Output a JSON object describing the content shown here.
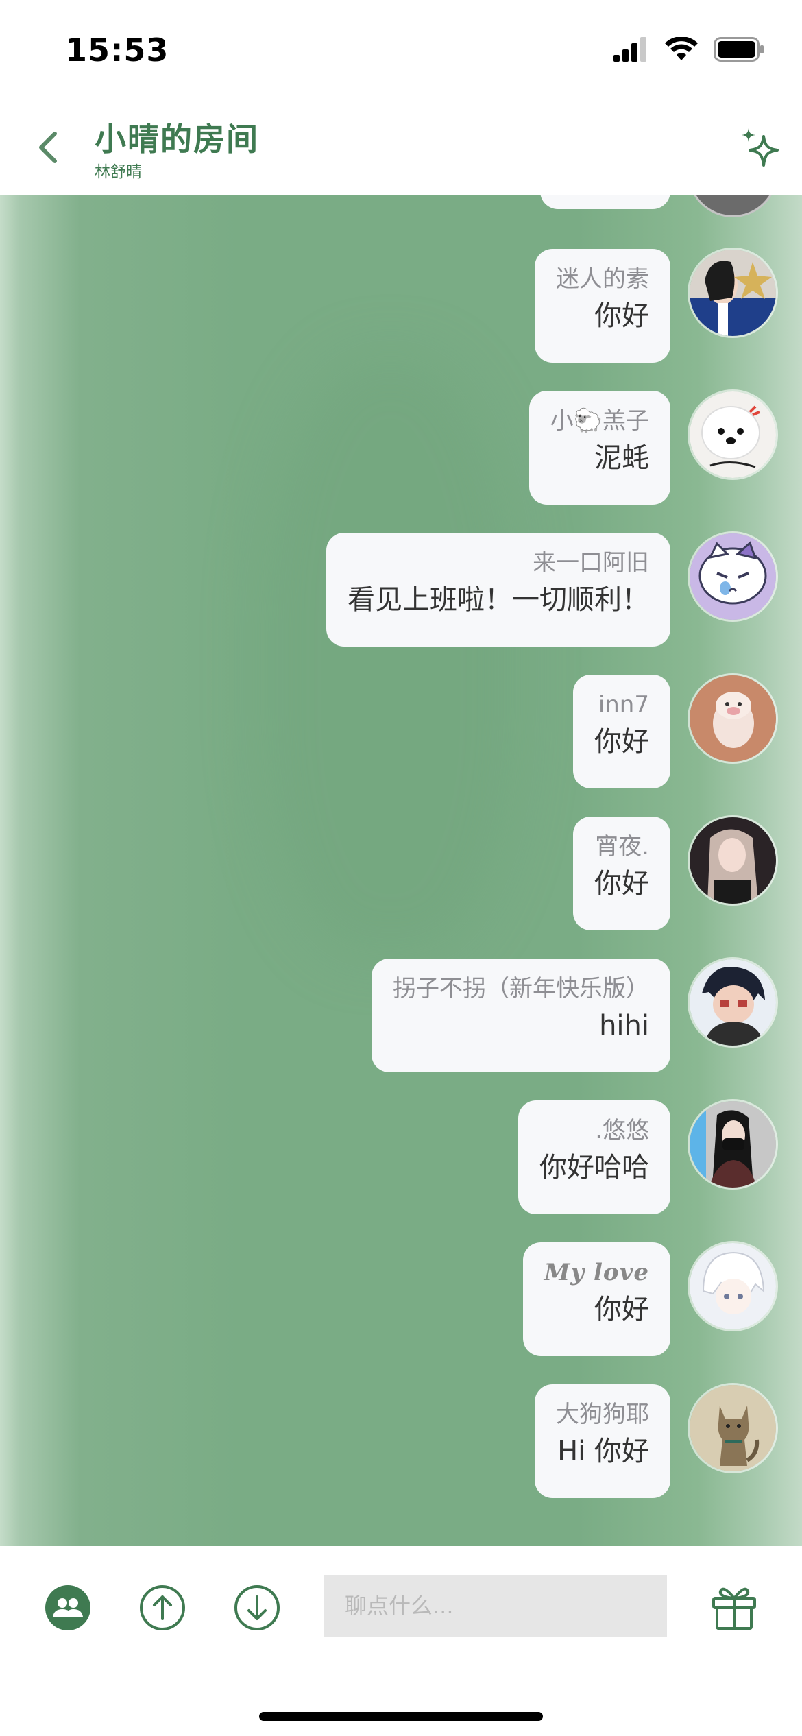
{
  "status_bar": {
    "time": "15:53"
  },
  "header": {
    "title": "小晴的房间",
    "subtitle": "林舒晴",
    "accent_color": "#3f7a51"
  },
  "messages": [
    {
      "name": "迷人的素",
      "text": "你好",
      "avatar": "avatar-girl-star"
    },
    {
      "name": "小🐑羔子",
      "text": "泥蚝",
      "avatar": "avatar-white-dog"
    },
    {
      "name": "来一口阿旧",
      "text": "看见上班啦！一切顺利！",
      "avatar": "avatar-cartoon-cat"
    },
    {
      "name": "inn7",
      "text": "你好",
      "avatar": "avatar-pig-figure"
    },
    {
      "name": "宵夜.",
      "text": "你好",
      "avatar": "avatar-girl-night"
    },
    {
      "name": "拐子不拐（新年快乐版）",
      "text": "hihi",
      "avatar": "avatar-anime-boy"
    },
    {
      "name": ".悠悠",
      "text": "你好哈哈",
      "avatar": "avatar-girl-mask"
    },
    {
      "name": "My love",
      "text": "你好",
      "avatar": "avatar-anime-girl"
    },
    {
      "name": "大狗狗耶",
      "text": "Hi 你好",
      "avatar": "avatar-cat-photo"
    }
  ],
  "input": {
    "placeholder": "聊点什么..."
  },
  "icons": {
    "back": "chevron-left-icon",
    "sparkle": "sparkle-icon",
    "members": "members-icon",
    "scroll_up": "arrow-up-circle-icon",
    "scroll_down": "arrow-down-circle-icon",
    "gift": "gift-icon"
  }
}
